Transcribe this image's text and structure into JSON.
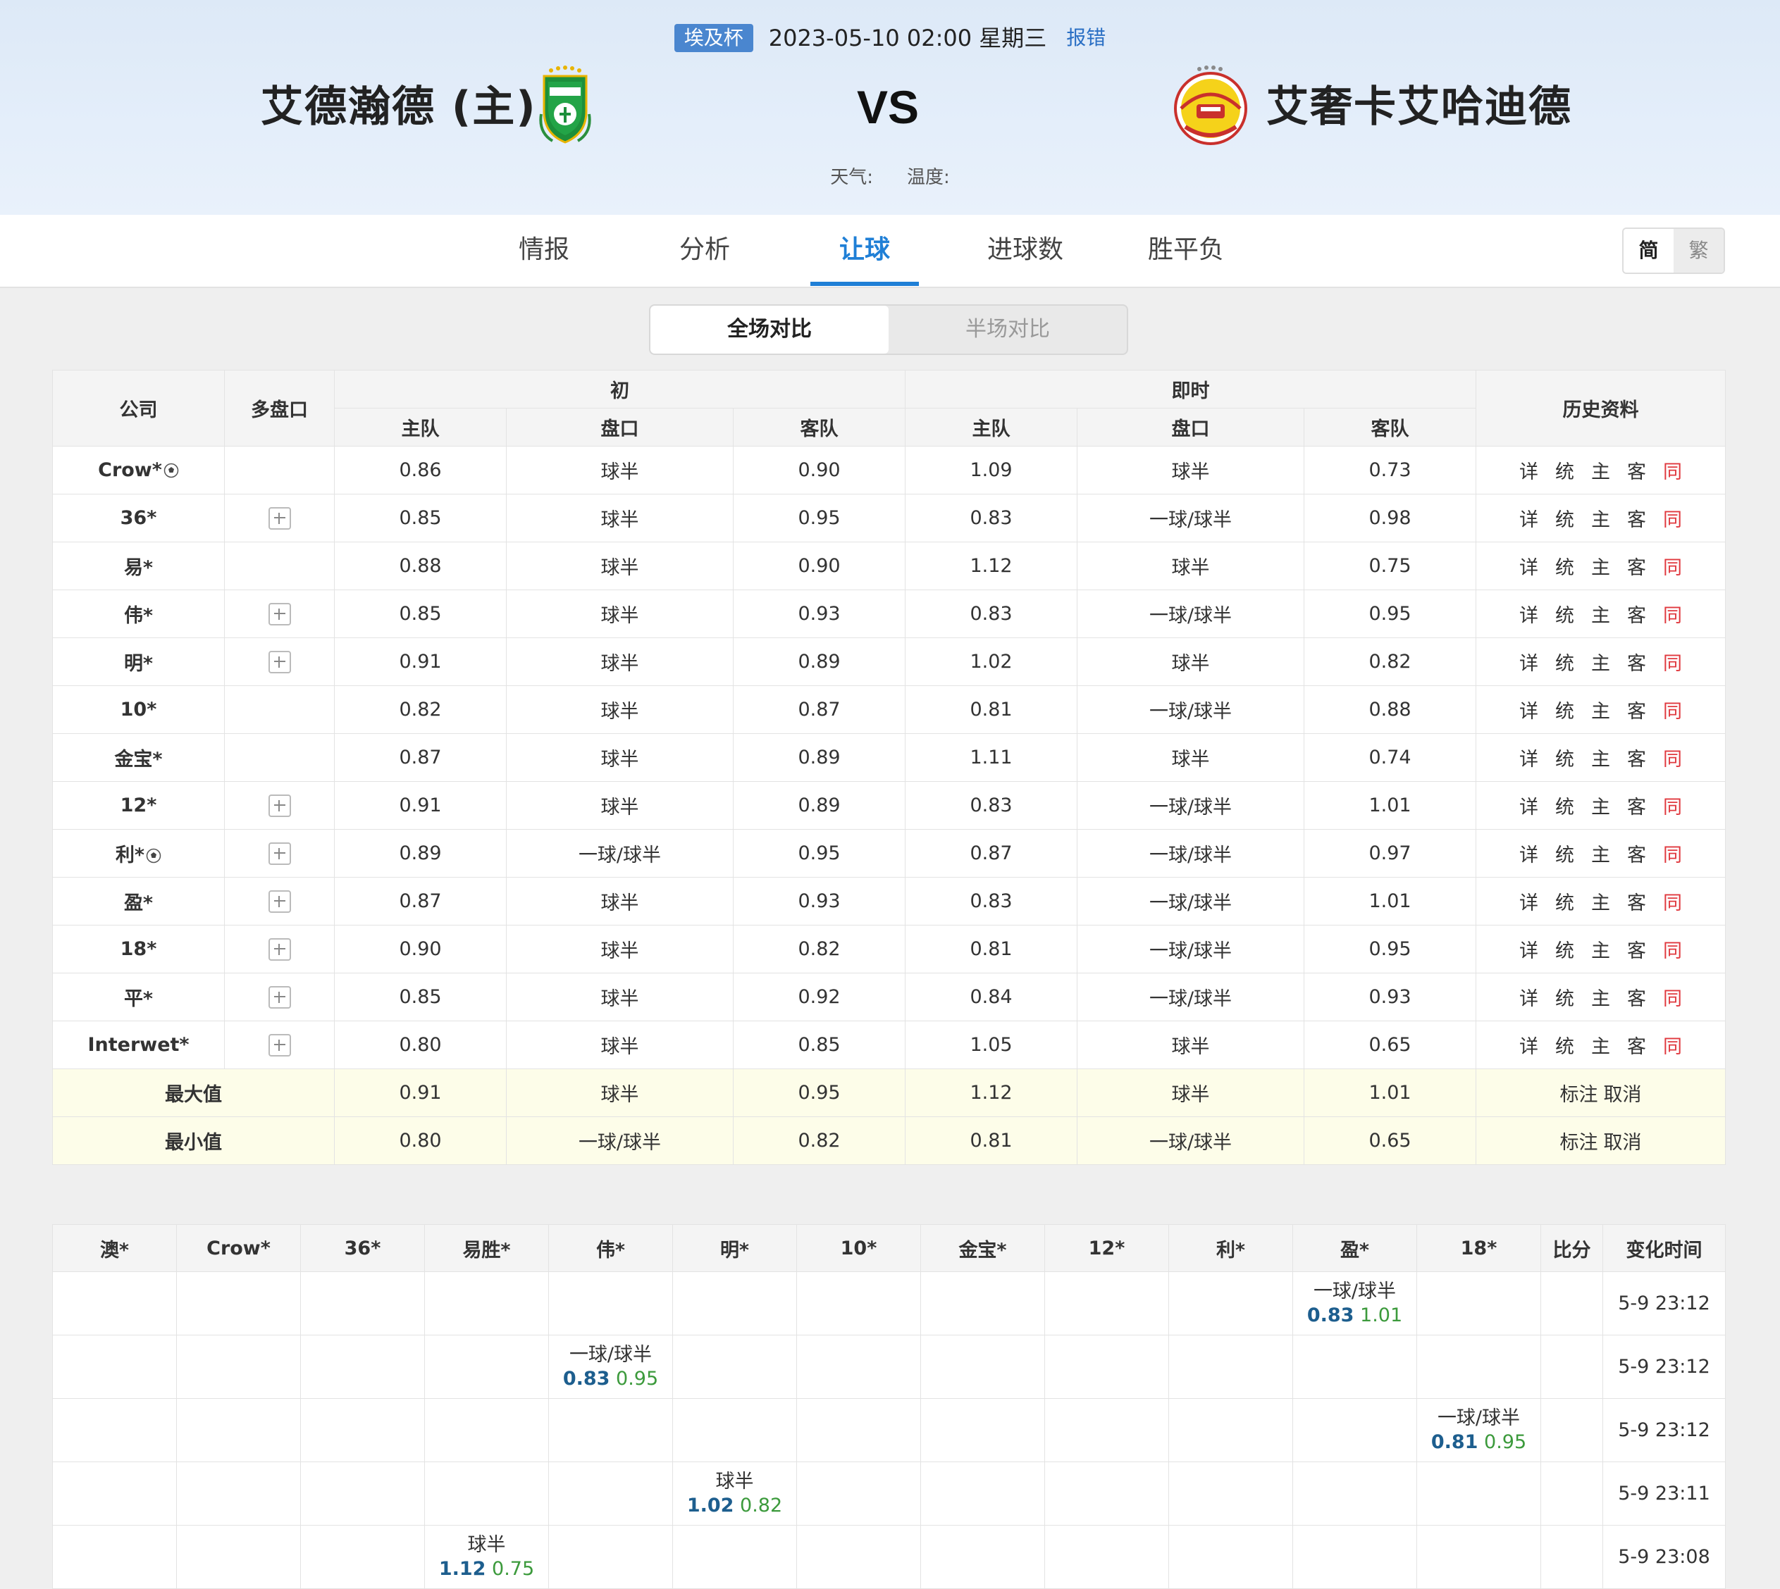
{
  "match": {
    "league": "埃及杯",
    "datetime": "2023-05-10 02:00 星期三",
    "report": "报错",
    "home_team": "艾德瀚德 (主)",
    "away_team": "艾奢卡艾哈迪德",
    "vs": "VS",
    "weather_label": "天气:",
    "temperature_label": "温度:"
  },
  "tabs": [
    "情报",
    "分析",
    "让球",
    "进球数",
    "胜平负"
  ],
  "active_tab": "让球",
  "lang": {
    "simplified": "简",
    "traditional": "繁"
  },
  "segments": {
    "full": "全场对比",
    "half": "半场对比"
  },
  "odds_table": {
    "headers": {
      "company": "公司",
      "multi": "多盘口",
      "initial": "初",
      "live": "即时",
      "history": "历史资料",
      "home": "主队",
      "line": "盘口",
      "away": "客队"
    },
    "history_links": [
      "详",
      "统",
      "主",
      "客",
      "同"
    ],
    "rows": [
      {
        "company": "Crow*",
        "ball": true,
        "plus": false,
        "i_home": "0.86",
        "i_line": "球半",
        "i_away": "0.90",
        "l_home": "1.09",
        "l_line": "球半",
        "l_away": "0.73"
      },
      {
        "company": "36*",
        "ball": false,
        "plus": true,
        "i_home": "0.85",
        "i_line": "球半",
        "i_away": "0.95",
        "l_home": "0.83",
        "l_line": "一球/球半",
        "l_away": "0.98"
      },
      {
        "company": "易*",
        "ball": false,
        "plus": false,
        "i_home": "0.88",
        "i_line": "球半",
        "i_away": "0.90",
        "l_home": "1.12",
        "l_line": "球半",
        "l_away": "0.75"
      },
      {
        "company": "伟*",
        "ball": false,
        "plus": true,
        "i_home": "0.85",
        "i_line": "球半",
        "i_away": "0.93",
        "l_home": "0.83",
        "l_line": "一球/球半",
        "l_away": "0.95"
      },
      {
        "company": "明*",
        "ball": false,
        "plus": true,
        "i_home": "0.91",
        "i_line": "球半",
        "i_away": "0.89",
        "l_home": "1.02",
        "l_line": "球半",
        "l_away": "0.82"
      },
      {
        "company": "10*",
        "ball": false,
        "plus": false,
        "i_home": "0.82",
        "i_line": "球半",
        "i_away": "0.87",
        "l_home": "0.81",
        "l_line": "一球/球半",
        "l_away": "0.88"
      },
      {
        "company": "金宝*",
        "ball": false,
        "plus": false,
        "i_home": "0.87",
        "i_line": "球半",
        "i_away": "0.89",
        "l_home": "1.11",
        "l_line": "球半",
        "l_away": "0.74"
      },
      {
        "company": "12*",
        "ball": false,
        "plus": true,
        "i_home": "0.91",
        "i_line": "球半",
        "i_away": "0.89",
        "l_home": "0.83",
        "l_line": "一球/球半",
        "l_away": "1.01"
      },
      {
        "company": "利*",
        "ball": true,
        "plus": true,
        "i_home": "0.89",
        "i_line": "一球/球半",
        "i_away": "0.95",
        "l_home": "0.87",
        "l_line": "一球/球半",
        "l_away": "0.97"
      },
      {
        "company": "盈*",
        "ball": false,
        "plus": true,
        "i_home": "0.87",
        "i_line": "球半",
        "i_away": "0.93",
        "l_home": "0.83",
        "l_line": "一球/球半",
        "l_away": "1.01"
      },
      {
        "company": "18*",
        "ball": false,
        "plus": true,
        "i_home": "0.90",
        "i_line": "球半",
        "i_away": "0.82",
        "l_home": "0.81",
        "l_line": "一球/球半",
        "l_away": "0.95"
      },
      {
        "company": "平*",
        "ball": false,
        "plus": true,
        "i_home": "0.85",
        "i_line": "球半",
        "i_away": "0.92",
        "l_home": "0.84",
        "l_line": "一球/球半",
        "l_away": "0.93"
      },
      {
        "company": "Interwet*",
        "ball": false,
        "plus": true,
        "i_home": "0.80",
        "i_line": "球半",
        "i_away": "0.85",
        "l_home": "1.05",
        "l_line": "球半",
        "l_away": "0.65"
      }
    ],
    "summary": [
      {
        "label": "最大值",
        "i_home": "0.91",
        "i_line": "球半",
        "i_away": "0.95",
        "l_home": "1.12",
        "l_line": "球半",
        "l_away": "1.01"
      },
      {
        "label": "最小值",
        "i_home": "0.80",
        "i_line": "一球/球半",
        "i_away": "0.82",
        "l_home": "0.81",
        "l_line": "一球/球半",
        "l_away": "0.65"
      }
    ],
    "mark_label": "标注",
    "cancel_label": "取消"
  },
  "change_table": {
    "headers": [
      "澳*",
      "Crow*",
      "36*",
      "易胜*",
      "伟*",
      "明*",
      "10*",
      "金宝*",
      "12*",
      "利*",
      "盈*",
      "18*",
      "比分",
      "变化时间"
    ],
    "rows": [
      {
        "col": 10,
        "line": "一球/球半",
        "home": "0.83",
        "away": "1.01",
        "time": "5-9 23:12"
      },
      {
        "col": 4,
        "line": "一球/球半",
        "home": "0.83",
        "away": "0.95",
        "time": "5-9 23:12"
      },
      {
        "col": 11,
        "line": "一球/球半",
        "home": "0.81",
        "away": "0.95",
        "time": "5-9 23:12"
      },
      {
        "col": 5,
        "line": "球半",
        "home": "1.02",
        "away": "0.82",
        "time": "5-9 23:11"
      },
      {
        "col": 3,
        "line": "球半",
        "home": "1.12",
        "away": "0.75",
        "time": "5-9 23:08"
      }
    ]
  },
  "colors": {
    "accent": "#1f7fd6",
    "badge": "#4a86cf",
    "same_link": "#e0383e",
    "home_odds": "#1d5e8e",
    "away_odds": "#3c9a3c",
    "summary_bg": "#fdfde9"
  }
}
